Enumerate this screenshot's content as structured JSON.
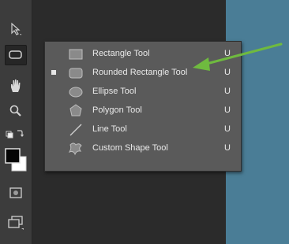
{
  "colors": {
    "accent_arrow": "#6fba3f",
    "canvas_blue": "#4a7d96",
    "flyout_bg": "#5a5a5a",
    "toolbar_bg": "#3c3c3c"
  },
  "toolbar": {
    "tools": [
      {
        "icon": "move-arrow-icon"
      },
      {
        "icon": "rectangle-shape-icon",
        "active": true
      },
      {
        "icon": "hand-icon"
      },
      {
        "icon": "zoom-icon"
      },
      {
        "icon": "swap-colors-icon"
      },
      {
        "icon": "color-swatches-icon"
      },
      {
        "icon": "quick-mask-icon"
      },
      {
        "icon": "screen-mode-icon"
      }
    ]
  },
  "shape_menu": {
    "items": [
      {
        "label": "Rectangle Tool",
        "shortcut": "U",
        "icon": "rectangle-icon",
        "selected": false
      },
      {
        "label": "Rounded Rectangle Tool",
        "shortcut": "U",
        "icon": "rounded-rectangle-icon",
        "selected": true
      },
      {
        "label": "Ellipse Tool",
        "shortcut": "U",
        "icon": "ellipse-icon",
        "selected": false
      },
      {
        "label": "Polygon Tool",
        "shortcut": "U",
        "icon": "polygon-icon",
        "selected": false
      },
      {
        "label": "Line Tool",
        "shortcut": "U",
        "icon": "line-icon",
        "selected": false
      },
      {
        "label": "Custom Shape Tool",
        "shortcut": "U",
        "icon": "custom-shape-icon",
        "selected": false
      }
    ]
  }
}
